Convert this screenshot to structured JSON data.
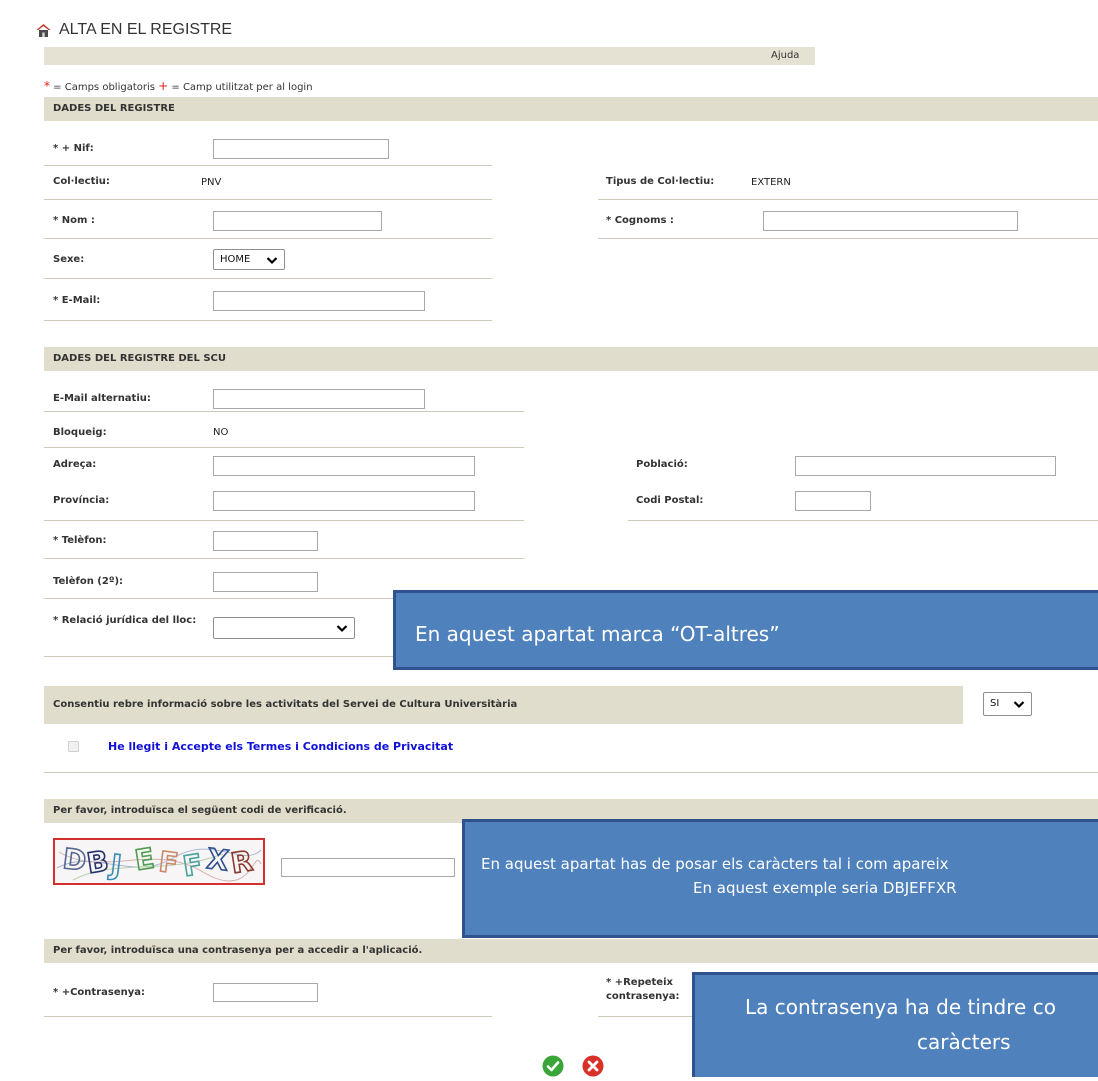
{
  "header": {
    "home_icon": "home-icon",
    "title": "ALTA EN EL REGISTRE",
    "help_link": "Ajuda"
  },
  "legend": {
    "required_mark": "*",
    "required_text": " = Camps obligatoris ",
    "login_mark": "+",
    "login_text": " = Camp utilitzat per al login",
    "mark_color": "#e0201b"
  },
  "registre": {
    "title": "DADES DEL REGISTRE",
    "nif": {
      "label": "* + Nif:",
      "value": ""
    },
    "collectiu": {
      "label": "Col·lectiu:",
      "value": "PNV"
    },
    "tipus_collectiu": {
      "label": "Tipus de Col·lectiu:",
      "value": "EXTERN"
    },
    "nom": {
      "label": "* Nom :",
      "value": ""
    },
    "cognoms": {
      "label": "* Cognoms :",
      "value": ""
    },
    "sexe": {
      "label": "Sexe:",
      "value": "HOME"
    },
    "email": {
      "label": "* E-Mail:",
      "value": ""
    }
  },
  "scu": {
    "title": "DADES DEL REGISTRE DEL SCU",
    "email_alt": {
      "label": "E-Mail alternatiu:",
      "value": ""
    },
    "bloqueig": {
      "label": "Bloqueig:",
      "value": "NO"
    },
    "adreca": {
      "label": "Adreça:",
      "value": ""
    },
    "poblacio": {
      "label": "Població:",
      "value": ""
    },
    "provincia": {
      "label": "Província:",
      "value": ""
    },
    "codi_postal": {
      "label": "Codi Postal:",
      "value": ""
    },
    "telefon": {
      "label": "* Telèfon:",
      "value": ""
    },
    "telefon2": {
      "label": "Telèfon (2º):",
      "value": ""
    },
    "relacio": {
      "label": "* Relació jurídica del lloc:",
      "value": ""
    }
  },
  "consent": {
    "label": "Consentiu rebre informació sobre les activitats del Servei de Cultura Universitària",
    "value": "SI",
    "privacy_checked": false,
    "privacy_link": "He llegit i Accepte els Termes i Condicions de Privacitat"
  },
  "verification": {
    "title": "Per favor, introduïsca el següent codi de verificació.",
    "captcha_code": "DBJEFFXR",
    "captcha_colors": [
      "#55688f",
      "#24336e",
      "#3c8db5",
      "#4f9e4f",
      "#c98b6b",
      "#4aa29c",
      "#2f4f8f",
      "#8b3a2f"
    ],
    "value": ""
  },
  "password": {
    "title": "Per favor, introduïsca una contrasenya per a accedir a l'aplicació.",
    "password_label": "* +Contrasenya:",
    "password_value": "",
    "repeat_label": "* +Repeteix contrasenya:",
    "repeat_value": ""
  },
  "actions": {
    "confirm_icon": "check-circle-icon",
    "cancel_icon": "close-circle-icon",
    "confirm_color": "#3aa63a",
    "cancel_color": "#d9302a"
  },
  "callouts": [
    {
      "lines": [
        "En aquest apartat marca “OT-altres”"
      ]
    },
    {
      "lines": [
        "En aquest apartat has de posar els caràcters tal i com apareix",
        "En aquest exemple seria DBJEFFXR"
      ]
    },
    {
      "lines": [
        "La contrasenya ha de tindre co",
        "caràcters"
      ]
    }
  ],
  "colors": {
    "section_bar": "#e1ddcc",
    "callout_fill": "#4f81bd",
    "callout_border": "#2f528f",
    "link": "#1010d8"
  }
}
